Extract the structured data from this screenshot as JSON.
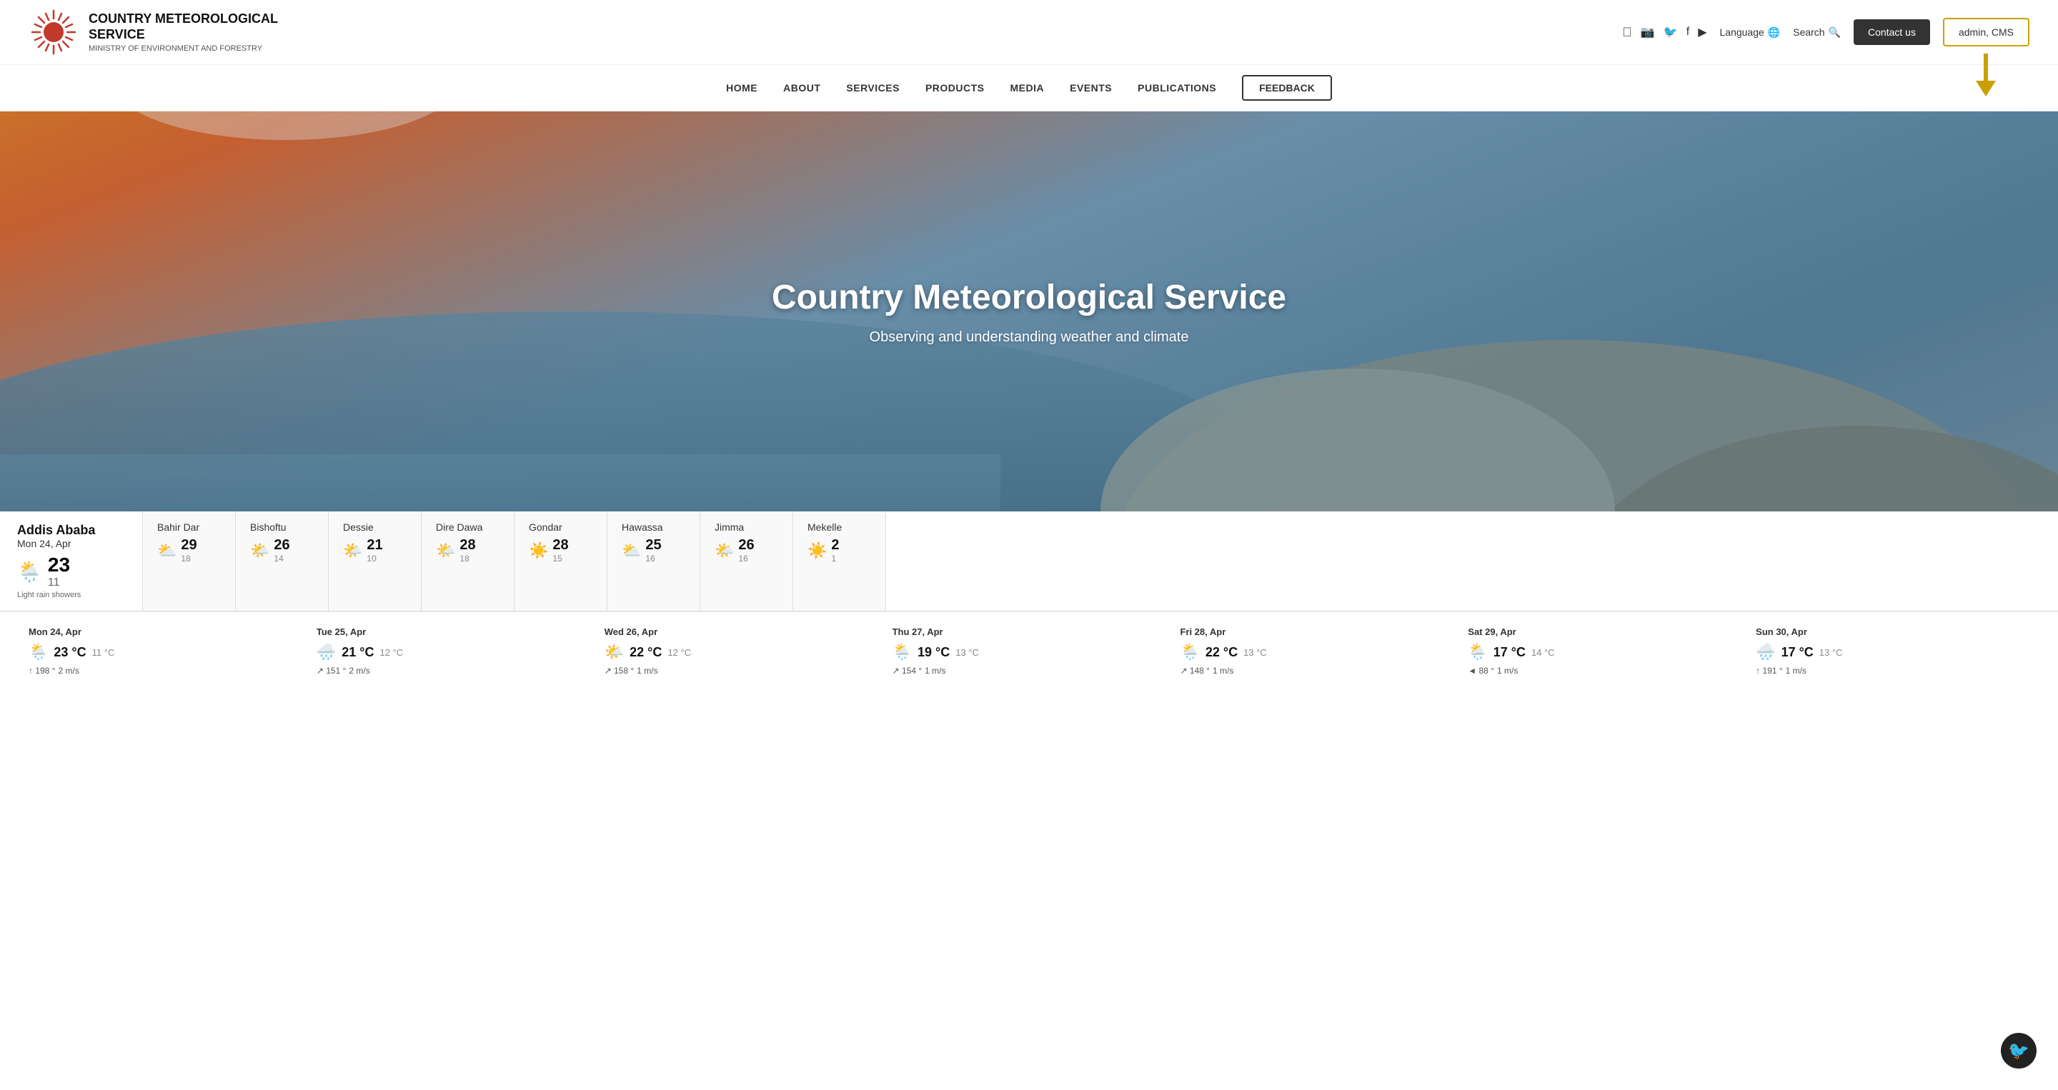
{
  "header": {
    "logo_title_line1": "COUNTRY METEOROLOGICAL",
    "logo_title_line2": "SERVICE",
    "logo_subtitle": "MINISTRY OF ENVIRONMENT AND FORESTRY",
    "search_label": "Search",
    "language_label": "Language",
    "contact_label": "Contact us",
    "admin_label": "admin, CMS",
    "social_icons": [
      "instagram",
      "twitter",
      "facebook",
      "youtube"
    ]
  },
  "nav": {
    "items": [
      {
        "label": "HOME",
        "id": "home"
      },
      {
        "label": "ABOUT",
        "id": "about"
      },
      {
        "label": "SERVICES",
        "id": "services"
      },
      {
        "label": "PRODUCTS",
        "id": "products"
      },
      {
        "label": "MEDIA",
        "id": "media"
      },
      {
        "label": "EVENTS",
        "id": "events"
      },
      {
        "label": "PUBLICATIONS",
        "id": "publications"
      }
    ],
    "feedback_label": "FEEDBACK"
  },
  "hero": {
    "title": "Country Meteorological Service",
    "subtitle": "Observing and understanding weather and climate"
  },
  "weather": {
    "active_city": {
      "name": "Addis Ababa",
      "date": "Mon 24, Apr",
      "icon": "🌦️",
      "temp_high": "23",
      "temp_low": "11",
      "description": "Light rain showers"
    },
    "cities": [
      {
        "name": "Bahir Dar",
        "icon": "⛅",
        "high": "29",
        "low": "18"
      },
      {
        "name": "Bishoftu",
        "icon": "🌤️",
        "high": "26",
        "low": "14"
      },
      {
        "name": "Dessie",
        "icon": "🌤️",
        "high": "21",
        "low": "10"
      },
      {
        "name": "Dire Dawa",
        "icon": "🌤️",
        "high": "28",
        "low": "18"
      },
      {
        "name": "Gondar",
        "icon": "☀️",
        "high": "28",
        "low": "15"
      },
      {
        "name": "Hawassa",
        "icon": "⛅",
        "high": "25",
        "low": "16"
      },
      {
        "name": "Jimma",
        "icon": "🌤️",
        "high": "26",
        "low": "16"
      },
      {
        "name": "Mekelle",
        "icon": "☀️",
        "high": "2",
        "low": "1"
      }
    ],
    "forecast": [
      {
        "date": "Mon 24, Apr",
        "icon": "🌦️",
        "high": "23 °C",
        "low": "11 °C",
        "wind_dir": "↑",
        "wind_deg": "198 °",
        "wind_speed": "2 m/s"
      },
      {
        "date": "Tue 25, Apr",
        "icon": "🌧️",
        "high": "21 °C",
        "low": "12 °C",
        "wind_dir": "↗",
        "wind_deg": "151 °",
        "wind_speed": "2 m/s"
      },
      {
        "date": "Wed 26, Apr",
        "icon": "🌤️",
        "high": "22 °C",
        "low": "12 °C",
        "wind_dir": "↗",
        "wind_deg": "158 °",
        "wind_speed": "1 m/s"
      },
      {
        "date": "Thu 27, Apr",
        "icon": "🌦️",
        "high": "19 °C",
        "low": "13 °C",
        "wind_dir": "↗",
        "wind_deg": "154 °",
        "wind_speed": "1 m/s"
      },
      {
        "date": "Fri 28, Apr",
        "icon": "🌦️",
        "high": "22 °C",
        "low": "13 °C",
        "wind_dir": "↗",
        "wind_deg": "148 °",
        "wind_speed": "1 m/s"
      },
      {
        "date": "Sat 29, Apr",
        "icon": "🌦️",
        "high": "17 °C",
        "low": "14 °C",
        "wind_dir": "◄",
        "wind_deg": "88 °",
        "wind_speed": "1 m/s"
      },
      {
        "date": "Sun 30, Apr",
        "icon": "🌧️",
        "high": "17 °C",
        "low": "13 °C",
        "wind_dir": "↑",
        "wind_deg": "191 °",
        "wind_speed": "1 m/s"
      }
    ]
  }
}
